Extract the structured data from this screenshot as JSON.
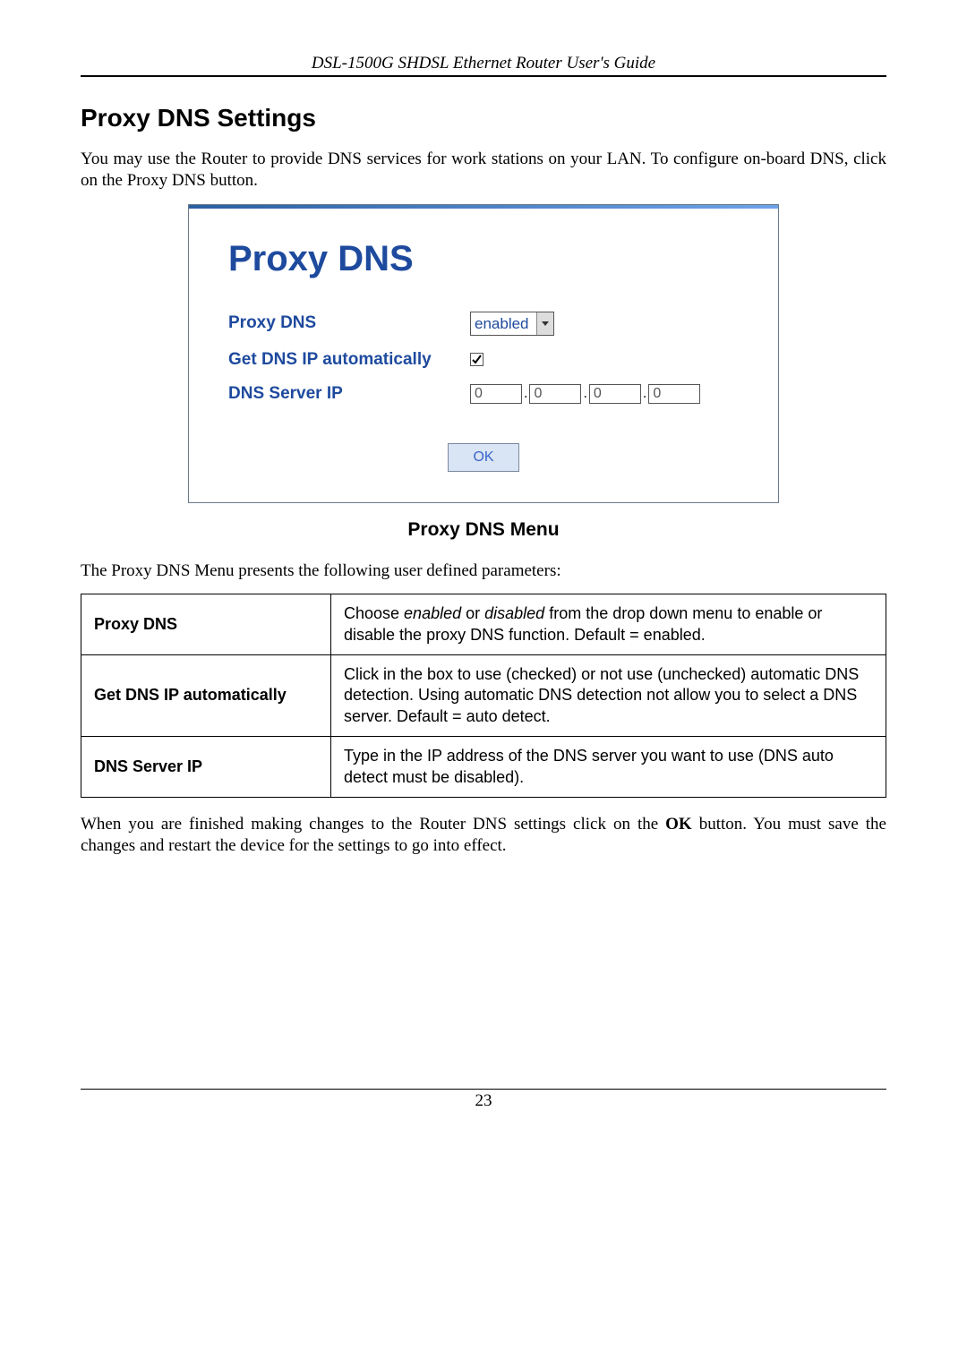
{
  "running_header": "DSL-1500G SHDSL Ethernet Router User's Guide",
  "section_title": "Proxy DNS Settings",
  "intro_text": "You may use the Router to provide DNS services for work stations on your LAN. To configure on-board DNS, click on the Proxy DNS button.",
  "screenshot": {
    "panel_title": "Proxy DNS",
    "rows": {
      "proxy_dns_label": "Proxy DNS",
      "proxy_dns_value": "enabled",
      "get_ip_label": "Get DNS IP automatically",
      "get_ip_checked": true,
      "dns_server_label": "DNS Server IP",
      "ip_octets": [
        "0",
        "0",
        "0",
        "0"
      ]
    },
    "ok_label": "OK"
  },
  "figure_caption": "Proxy DNS Menu",
  "table_intro": "The Proxy DNS Menu presents the following user defined parameters:",
  "params": [
    {
      "name": "Proxy DNS",
      "desc_prefix": "Choose ",
      "desc_em1": "enabled",
      "desc_mid": " or ",
      "desc_em2": "disabled",
      "desc_suffix": " from the drop down menu to enable or disable the proxy DNS function. Default = enabled."
    },
    {
      "name": "Get DNS IP automatically",
      "desc": "Click in the box to use (checked) or not use (unchecked) automatic DNS detection. Using automatic DNS detection not allow you to select a DNS server. Default = auto detect."
    },
    {
      "name": "DNS Server IP",
      "desc": "Type in the IP address of the DNS server you want to use (DNS auto detect must be disabled)."
    }
  ],
  "closing_text_pre": "When you are finished making changes to the Router DNS settings click on the ",
  "closing_text_bold": "OK",
  "closing_text_post": " button. You must save the changes and restart the device for the settings to go into effect.",
  "page_number": "23"
}
